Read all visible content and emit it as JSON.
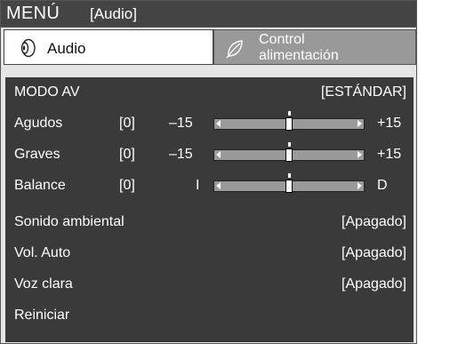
{
  "menu": {
    "title": "MENÚ",
    "section": "[Audio]"
  },
  "tabs": [
    {
      "label": "Audio",
      "icon": "speaker-icon",
      "active": true
    },
    {
      "label_line1": "Control",
      "label_line2": "alimentación",
      "icon": "leaf-icon",
      "active": false
    }
  ],
  "settings": {
    "modo_av": {
      "label": "MODO AV",
      "value": "[ESTÁNDAR]"
    },
    "agudos": {
      "label": "Agudos",
      "value": "[0]",
      "min_label": "–15",
      "max_label": "+15",
      "level": 0,
      "range": [
        -15,
        15
      ]
    },
    "graves": {
      "label": "Graves",
      "value": "[0]",
      "min_label": "–15",
      "max_label": "+15",
      "level": 0,
      "range": [
        -15,
        15
      ]
    },
    "balance": {
      "label": "Balance",
      "value": "[0]",
      "min_label": "I",
      "max_label": "D",
      "level": 0,
      "range": [
        -15,
        15
      ]
    },
    "sonido_ambiental": {
      "label": "Sonido ambiental",
      "value": "[Apagado]"
    },
    "vol_auto": {
      "label": "Vol. Auto",
      "value": "[Apagado]"
    },
    "voz_clara": {
      "label": "Voz clara",
      "value": "[Apagado]"
    },
    "reiniciar": {
      "label": "Reiniciar"
    }
  },
  "colors": {
    "header_bg": "#444444",
    "panel_bg": "#3a3a3a",
    "frame_bg": "#e6e6e6",
    "slider_track": "#9a9a9a",
    "inactive_tab": "#999999"
  }
}
